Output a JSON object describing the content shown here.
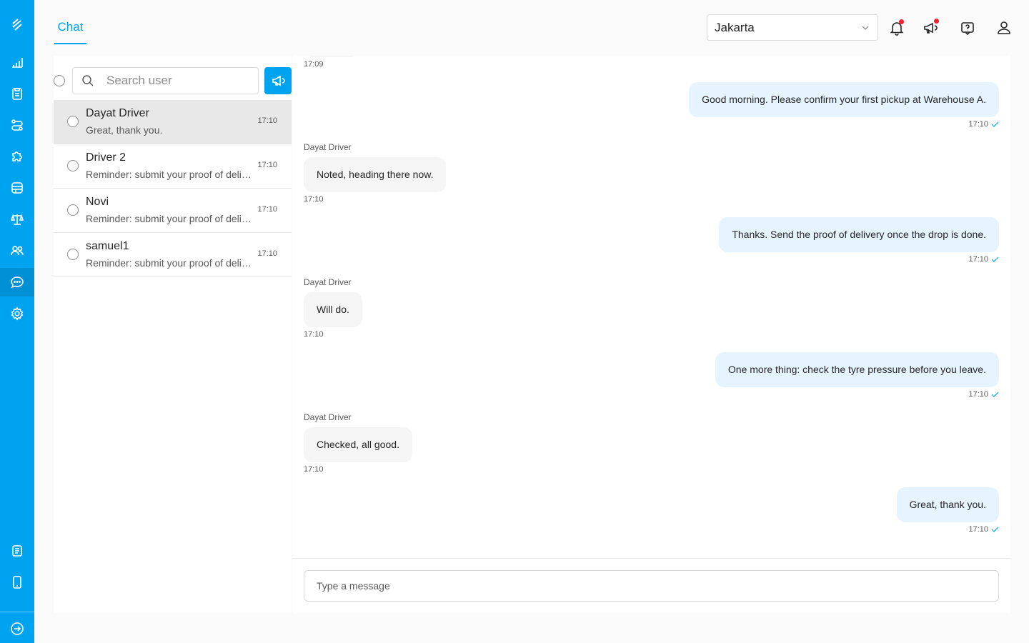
{
  "sidebar": {
    "items": [
      {
        "icon": "logo-icon"
      },
      {
        "icon": "bar-chart-icon"
      },
      {
        "icon": "clipboard-icon"
      },
      {
        "icon": "route-icon"
      },
      {
        "icon": "puzzle-icon"
      },
      {
        "icon": "database-icon"
      },
      {
        "icon": "balance-scale-icon"
      },
      {
        "icon": "users-icon"
      },
      {
        "icon": "chat-icon",
        "active": true
      },
      {
        "icon": "gear-icon"
      },
      {
        "icon": "document-icon"
      },
      {
        "icon": "mobile-icon"
      },
      {
        "icon": "logout-icon"
      }
    ],
    "color": "#00a3ef"
  },
  "header": {
    "tab": "Chat",
    "city": "Jakarta",
    "icons": [
      "bell-icon",
      "megaphone-icon",
      "help-icon",
      "user-icon"
    ]
  },
  "chat_list": {
    "search_placeholder": "Search user",
    "conversations": [
      {
        "name": "Dayat Driver",
        "preview": "Great, thank you.",
        "time": "17:10",
        "selected": true
      },
      {
        "name": "Driver 2",
        "preview": "Reminder: submit your proof of delivery",
        "time": "17:10"
      },
      {
        "name": "Novi",
        "preview": "Reminder: submit your proof of delivery",
        "time": "17:10"
      },
      {
        "name": "samuel1",
        "preview": "Reminder: submit your proof of delivery",
        "time": "17:10"
      }
    ]
  },
  "conversation": {
    "first_time": "17:09",
    "messages": [
      {
        "dir": "out",
        "text": "Good morning. Please confirm your first pickup at Warehouse A.",
        "time": "17:10"
      },
      {
        "dir": "in",
        "sender": "Dayat Driver",
        "text": "Noted, heading there now.",
        "time": "17:10"
      },
      {
        "dir": "out",
        "text": "Thanks. Send the proof of delivery once the drop is done.",
        "time": "17:10"
      },
      {
        "dir": "in",
        "sender": "Dayat Driver",
        "text": "Will do.",
        "time": "17:10"
      },
      {
        "dir": "out",
        "text": "One more thing: check the tyre pressure before you leave.",
        "time": "17:10"
      },
      {
        "dir": "in",
        "sender": "Dayat Driver",
        "text": "Checked, all good.",
        "time": "17:10"
      },
      {
        "dir": "out",
        "text": "Great, thank you.",
        "time": "17:10"
      }
    ],
    "composer_placeholder": "Type a message"
  }
}
